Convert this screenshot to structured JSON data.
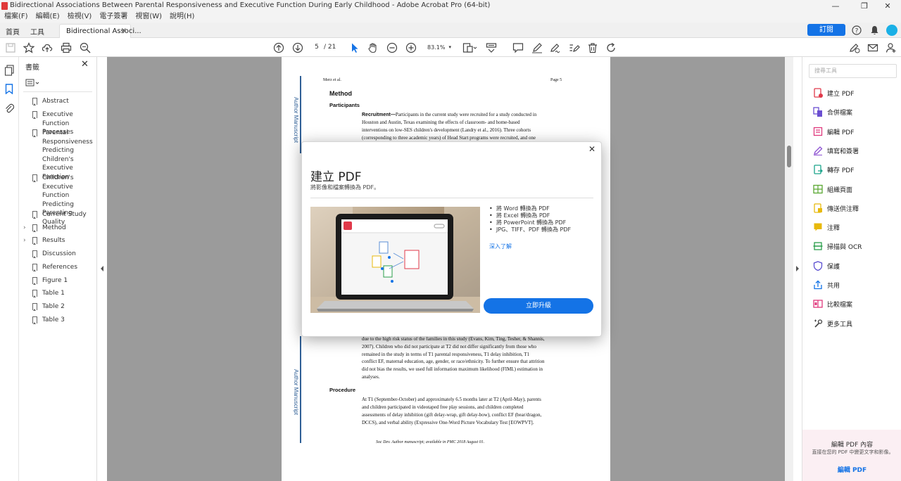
{
  "window": {
    "title": "Bidirectional Associations Between Parental Responsiveness and Executive Function During Early Childhood - Adobe Acrobat Pro (64-bit)"
  },
  "menu": [
    "檔案(F)",
    "編輯(E)",
    "檢視(V)",
    "電子簽署",
    "視窗(W)",
    "說明(H)"
  ],
  "tabs": {
    "home": "首頁",
    "tools": "工具",
    "document": "Bidirectional Associ...",
    "close": "×"
  },
  "header": {
    "buy_label": "訂閱"
  },
  "toolbar": {
    "page_current": "5",
    "page_total": "/ 21",
    "zoom": "83.1%"
  },
  "bookmarks": {
    "title": "書籤",
    "close": "✕",
    "items": [
      {
        "label": "Abstract",
        "expandable": false
      },
      {
        "label": "Executive Function Processes",
        "expandable": false
      },
      {
        "label": "Parental Responsiveness Predicting Children's Executive Function",
        "expandable": false
      },
      {
        "label": "Children's Executive Function Predicting Parenting Quality",
        "expandable": false
      },
      {
        "label": "Current Study",
        "expandable": false
      },
      {
        "label": "Method",
        "expandable": true
      },
      {
        "label": "Results",
        "expandable": true
      },
      {
        "label": "Discussion",
        "expandable": false
      },
      {
        "label": "References",
        "expandable": false
      },
      {
        "label": "Figure 1",
        "expandable": false
      },
      {
        "label": "Table 1",
        "expandable": false
      },
      {
        "label": "Table 2",
        "expandable": false
      },
      {
        "label": "Table 3",
        "expandable": false
      }
    ]
  },
  "pdf": {
    "running_head_left": "Merz et al.",
    "running_head_right": "Page 5",
    "side_label": "Author Manuscript",
    "method_heading": "Method",
    "participants_heading": "Participants",
    "recruitment_label": "Recruitment—",
    "para1": [
      "Participants in the current study were recruited for a study conducted in",
      "Houston and Austin, Texas examining the effects of classroom- and home-based",
      "interventions on low-SES children's development (Landry et al., 2016). Three cohorts",
      "(corresponding to three academic years) of Head Start programs were recruited, and one"
    ],
    "para2": [
      "due to the high risk status of the families in this study (Evans, Kim, Ting, Tesher, & Shannis,",
      "2007). Children who did not participate at T2 did not differ significantly from those who",
      "remained in the study in terms of T1 parental responsiveness, T1 delay inhibition, T1",
      "conflict EF, maternal education, age, gender, or race/ethnicity. To further ensure that attrition",
      "did not bias the results, we used full information maximum likelihood (FIML) estimation in",
      "analyses."
    ],
    "procedure_heading": "Procedure",
    "para3": [
      "At T1 (September-October) and approximately 6.5 months later at T2 (April-May), parents",
      "and children participated in videotaped free play sessions, and children completed",
      "assessments of delay inhibition (gift delay-wrap, gift delay-bow), conflict EF (bear/dragon,",
      "DCCS), and verbal ability (Expressive One-Word Picture Vocabulary Test [EOWPVT]."
    ],
    "footer": "Soc Dev. Author manuscript; available in PMC 2018 August 01."
  },
  "dialog": {
    "close": "✕",
    "title": "建立 PDF",
    "subtitle": "將影像和檔案轉換為 PDF。",
    "features": [
      "將 Word 轉換為 PDF",
      "將 Excel 轉換為 PDF",
      "將 PowerPoint 轉換為 PDF",
      "JPG、TIFF、PDF 轉換為 PDF"
    ],
    "learn_more": "深入了解",
    "upgrade_button": "立即升級"
  },
  "tools_pane": {
    "search_placeholder": "搜尋工具",
    "tools": [
      {
        "label": "建立 PDF",
        "icon": "create-pdf-icon",
        "color": "#e0394a"
      },
      {
        "label": "合併檔案",
        "icon": "combine-files-icon",
        "color": "#6b4fd1"
      },
      {
        "label": "編輯 PDF",
        "icon": "edit-pdf-icon",
        "color": "#e0397d"
      },
      {
        "label": "填寫和簽署",
        "icon": "fill-sign-icon",
        "color": "#8b4fd1"
      },
      {
        "label": "轉存 PDF",
        "icon": "export-pdf-icon",
        "color": "#1aa38a"
      },
      {
        "label": "組織頁面",
        "icon": "organize-pages-icon",
        "color": "#5aa832"
      },
      {
        "label": "傳送供注釋",
        "icon": "send-comments-icon",
        "color": "#e8b90c"
      },
      {
        "label": "注釋",
        "icon": "comment-icon",
        "color": "#e8b90c"
      },
      {
        "label": "掃描與 OCR",
        "icon": "scan-ocr-icon",
        "color": "#2a9d4a"
      },
      {
        "label": "保護",
        "icon": "protect-icon",
        "color": "#5b4fd1"
      },
      {
        "label": "共用",
        "icon": "share-icon",
        "color": "#1473e6"
      },
      {
        "label": "比較檔案",
        "icon": "compare-files-icon",
        "color": "#e0397d"
      },
      {
        "label": "更多工具",
        "icon": "more-tools-icon",
        "color": "#444444"
      }
    ],
    "promo": {
      "title": "編輯 PDF 內容",
      "body": "直接在您的 PDF 中變更文字和影像。",
      "link": "編輯 PDF"
    }
  }
}
